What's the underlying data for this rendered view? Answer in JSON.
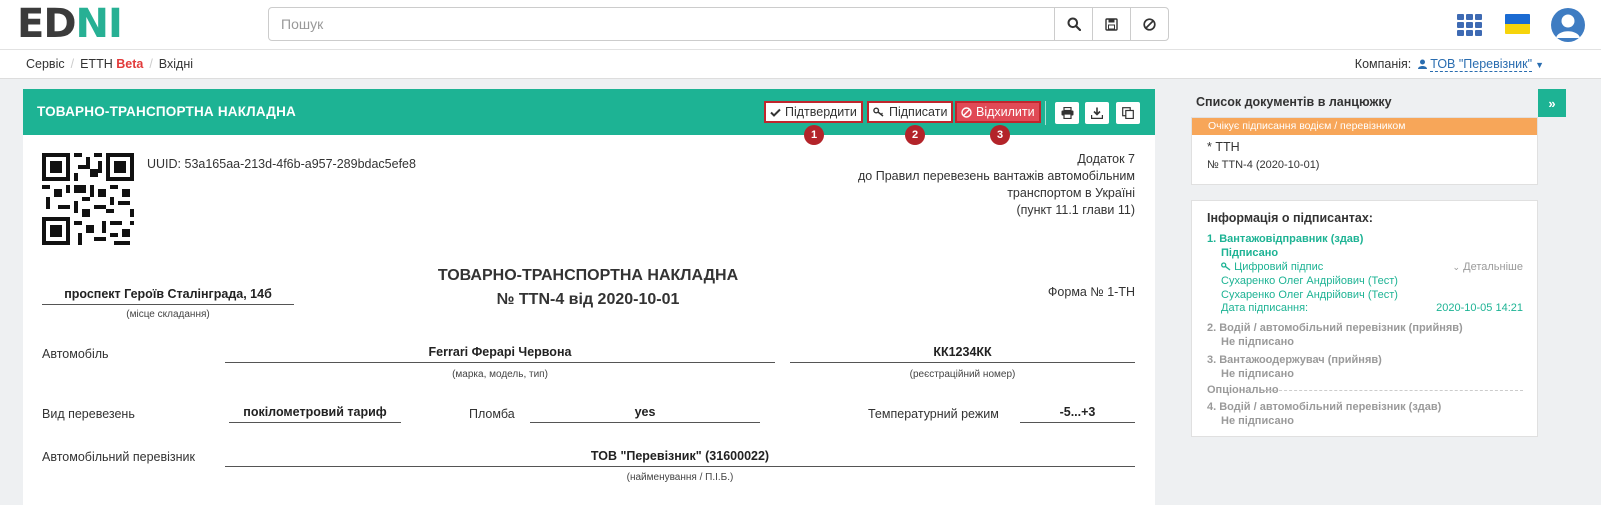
{
  "header": {
    "logo_part1": "ED",
    "logo_part2": "N",
    "logo_part3": "I",
    "search_placeholder": "Пошук",
    "icons": [
      "search-icon",
      "save-icon",
      "clear-icon",
      "apps-grid-icon",
      "ukraine-flag-icon",
      "user-avatar-icon"
    ]
  },
  "breadcrumb": {
    "items": [
      "Сервіс",
      "ЕТТН",
      "Beta",
      "Вхідні"
    ],
    "separator": "/"
  },
  "company": {
    "label": "Компанія:",
    "value": "ТОВ \"Перевізник\""
  },
  "document": {
    "header_title": "ТОВАРНО-ТРАНСПОРТНА НАКЛАДНА",
    "actions": [
      {
        "label": "Підтвердити",
        "badge": "1"
      },
      {
        "label": "Підписати",
        "badge": "2"
      },
      {
        "label": "Відхилити",
        "badge": "3"
      }
    ],
    "tool_icons": [
      "print-icon",
      "download-icon",
      "copy-icon"
    ],
    "uuid": "UUID: 53a165aa-213d-4f6b-a957-289bdac5efe8",
    "appendix": [
      "Додаток 7",
      "до Правил перевезень вантажів автомобільним",
      "транспортом в Україні",
      "(пункт 11.1 глави 11)"
    ],
    "place_value": "проспект Героїв Сталінграда, 14б",
    "place_caption": "(місце складання)",
    "title_line1": "ТОВАРНО-ТРАНСПОРТНА НАКЛАДНА",
    "title_line2": "№ TTN-4 від 2020-10-01",
    "form_no": "Форма № 1-ТН",
    "fields": {
      "car_label": "Автомобіль",
      "car_value": "Ferrari Ферарі Червона",
      "car_caption": "(марка, модель, тип)",
      "reg_value": "КК1234КК",
      "reg_caption": "(реєстраційний номер)",
      "transport_type_label": "Вид перевезень",
      "transport_type_value": "покілометровий тариф",
      "seal_label": "Пломба",
      "seal_value": "yes",
      "temp_label": "Температурний режим",
      "temp_value": "-5...+3",
      "carrier_label": "Автомобільний перевізник",
      "carrier_value": "ТОВ \"Перевізник\" (31600022)",
      "carrier_caption": "(найменування / П.І.Б.)"
    }
  },
  "chain": {
    "title": "Список документів в ланцюжку",
    "status": "Очікує підписання водієм / перевізником",
    "doc_name": "* ТТН",
    "doc_number": "№ TTN-4 (2020-10-01)"
  },
  "signers": {
    "title": "Інформація о підписантах:",
    "s1_title": "1.  Вантажовідправник (здав)",
    "s1_status": "Підписано",
    "s1_sig": "Цифровий підпис",
    "s1_details": "Детальніше",
    "s1_name1": "Сухаренко Олег Андрійович (Тест)",
    "s1_name2": "Сухаренко Олег Андрійович (Тест)",
    "s1_date_label": "Дата підписання:",
    "s1_date": "2020-10-05 14:21",
    "s2_title": "2.  Водій / автомобільний перевізник (прийняв)",
    "s2_status": "Не підписано",
    "s3_title": "3.  Вантажоодержувач (прийняв)",
    "s3_status": "Не підписано",
    "optional": "Опціонально",
    "s4_title": "4.  Водій / автомобільний перевізник (здав)",
    "s4_status": "Не підписано"
  },
  "expand_label": "»",
  "colors": {
    "accent": "#1db394",
    "status_orange": "#f7a659",
    "reject": "#e04a56",
    "highlight": "#c0262d"
  }
}
